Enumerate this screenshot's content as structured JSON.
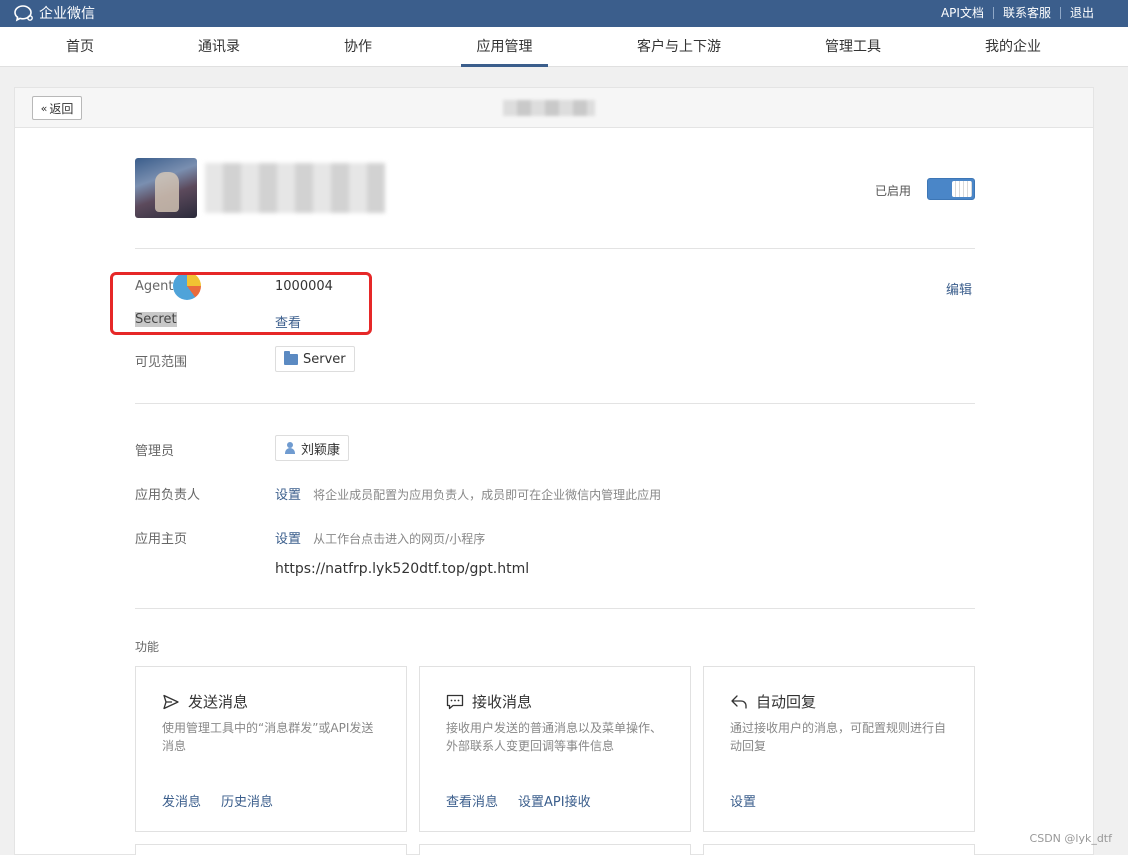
{
  "topbar": {
    "logo_text": "企业微信",
    "links": [
      "API文档",
      "联系客服",
      "退出"
    ]
  },
  "nav": {
    "items": [
      "首页",
      "通讯录",
      "协作",
      "应用管理",
      "客户与上下游",
      "管理工具",
      "我的企业"
    ],
    "active": "应用管理"
  },
  "header": {
    "back_label": "返回"
  },
  "app": {
    "status_label": "已启用",
    "enabled": true
  },
  "details": {
    "agent_label": "Agent",
    "agent_value": "1000004",
    "secret_label": "Secret",
    "secret_link": "查看",
    "edit_link": "编辑",
    "visibility_label": "可见范围",
    "visibility_tag": "Server"
  },
  "admin": {
    "admin_label": "管理员",
    "admin_name": "刘颖康",
    "owner_label": "应用负责人",
    "owner_link": "设置",
    "owner_hint": "将企业成员配置为应用负责人，成员即可在企业微信内管理此应用",
    "home_label": "应用主页",
    "home_link": "设置",
    "home_hint": "从工作台点击进入的网页/小程序",
    "home_url": "https://natfrp.lyk520dtf.top/gpt.html"
  },
  "features": {
    "title": "功能",
    "cards": [
      {
        "icon": "send-icon",
        "title": "发送消息",
        "desc": "使用管理工具中的“消息群发”或API发送消息",
        "actions": [
          "发消息",
          "历史消息"
        ]
      },
      {
        "icon": "chat-icon",
        "title": "接收消息",
        "desc": "接收用户发送的普通消息以及菜单操作、外部联系人变更回调等事件信息",
        "actions": [
          "查看消息",
          "设置API接收"
        ]
      },
      {
        "icon": "reply-icon",
        "title": "自动回复",
        "desc": "通过接收用户的消息，可配置规则进行自动回复",
        "actions": [
          "设置"
        ]
      }
    ]
  },
  "watermark": "CSDN @lyk_dtf",
  "colors": {
    "brand": "#3b5e8c",
    "toggle": "#4a86c8",
    "highlight_box": "#e62828"
  }
}
